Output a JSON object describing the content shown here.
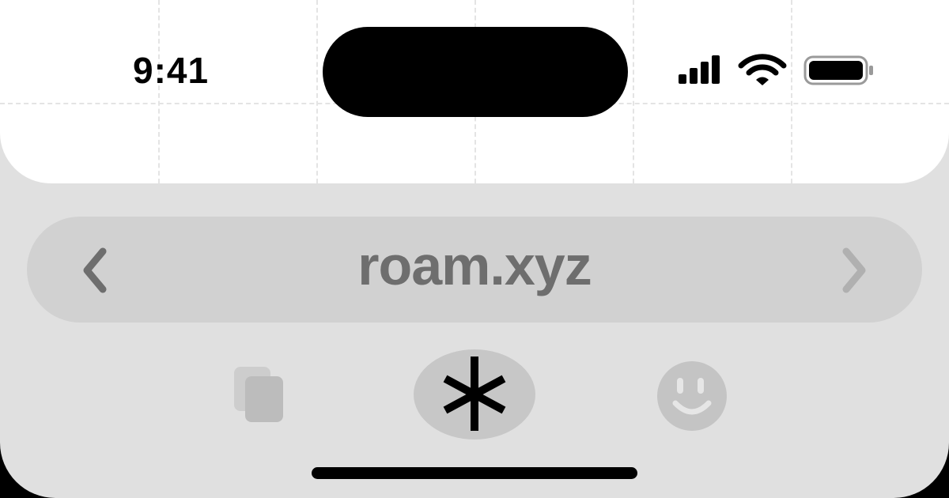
{
  "status_bar": {
    "time": "9:41",
    "icons": [
      "cellular-signal-icon",
      "wifi-icon",
      "battery-icon"
    ]
  },
  "browser": {
    "address_bar": {
      "url": "roam.xyz",
      "back_icon": "chevron-left-icon",
      "forward_icon": "chevron-right-icon"
    },
    "toolbar": {
      "items": [
        {
          "name": "tabs",
          "icon": "tabs-icon"
        },
        {
          "name": "ai",
          "icon": "asterisk-icon"
        },
        {
          "name": "profile",
          "icon": "smiley-face-icon"
        }
      ]
    }
  },
  "colors": {
    "webview_bg": "#ffffff",
    "chrome_bg": "#e0e0e0",
    "address_bar_bg": "#d1d1d1",
    "url_text": "#6e6e6e",
    "island": "#000000"
  }
}
